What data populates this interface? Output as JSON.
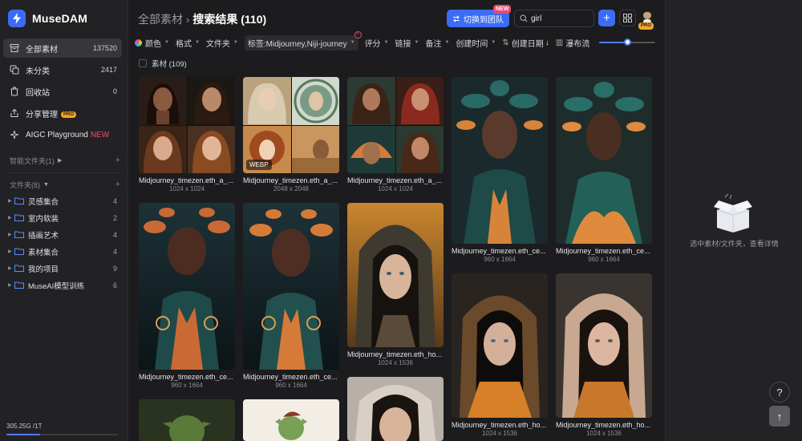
{
  "app": {
    "name": "MuseDAM"
  },
  "sidebar": {
    "nav": [
      {
        "label": "全部素材",
        "count": "137520",
        "icon": "archive-icon",
        "active": true
      },
      {
        "label": "未分类",
        "count": "2417",
        "icon": "copy-icon"
      },
      {
        "label": "回收站",
        "count": "0",
        "icon": "trash-icon"
      },
      {
        "label": "分享管理",
        "badge": "PRO",
        "icon": "share-icon"
      },
      {
        "label": "AIGC Playground",
        "tag": "NEW",
        "icon": "sparkle-icon"
      }
    ],
    "smart_section": "智能文件夹(1)",
    "folder_section": "文件夹(8)",
    "folders": [
      {
        "label": "灵感集合",
        "count": "4"
      },
      {
        "label": "室内软装",
        "count": "2"
      },
      {
        "label": "插画艺术",
        "count": "4"
      },
      {
        "label": "素材集合",
        "count": "4"
      },
      {
        "label": "我的项目",
        "count": "9"
      },
      {
        "label": "MuseAI模型训练",
        "count": "6"
      }
    ],
    "storage": "305.25G /1T",
    "storage_used": 0.3
  },
  "header": {
    "root": "全部素材",
    "current": "搜索结果 (110)",
    "team_button": "切换到团队",
    "new_badge": "NEW",
    "search_value": "girl",
    "avatar_badge": "PRO"
  },
  "filters": {
    "color": "颜色",
    "format": "格式",
    "folder": "文件夹",
    "tag": "标签:Midjourney,Niji-journey",
    "rating": "评分",
    "link": "链接",
    "note": "备注",
    "created": "创建时间",
    "sort": "创建日期",
    "layout": "瀑布流",
    "zoom": 0.5
  },
  "select_all": "素材 (109)",
  "assets": [
    {
      "name": "Midjourney_timezen.eth_a_...",
      "dim": "1024 x 1024"
    },
    {
      "name": "Midjourney_timezen.eth_a_...",
      "dim": "2048 x 2048",
      "badge": "WEBP"
    },
    {
      "name": "Midjourney_timezen.eth_a_...",
      "dim": "1024 x 1024"
    },
    {
      "name": "Midjourney_timezen.eth_ce...",
      "dim": "960 x 1664"
    },
    {
      "name": "Midjourney_timezen.eth_ce...",
      "dim": "960 x 1664"
    },
    {
      "name": "Midjourney_timezen.eth_ce...",
      "dim": "960 x 1664"
    },
    {
      "name": "Midjourney_timezen.eth_ce...",
      "dim": "960 x 1664"
    },
    {
      "name": "Midjourney_timezen.eth_ho...",
      "dim": "1024 x 1536"
    },
    {
      "name": "Midjourney_timezen.eth_ho...",
      "dim": "1024 x 1536"
    },
    {
      "name": "Midjourney_timezen.eth_ho...",
      "dim": "1024 x 1536"
    }
  ],
  "detail": {
    "empty_text": "选中素材/文件夹，查看详情"
  },
  "colors": {
    "accent": "#3b6cf6",
    "new": "#ec4a6a",
    "pro": "#f5a623"
  }
}
